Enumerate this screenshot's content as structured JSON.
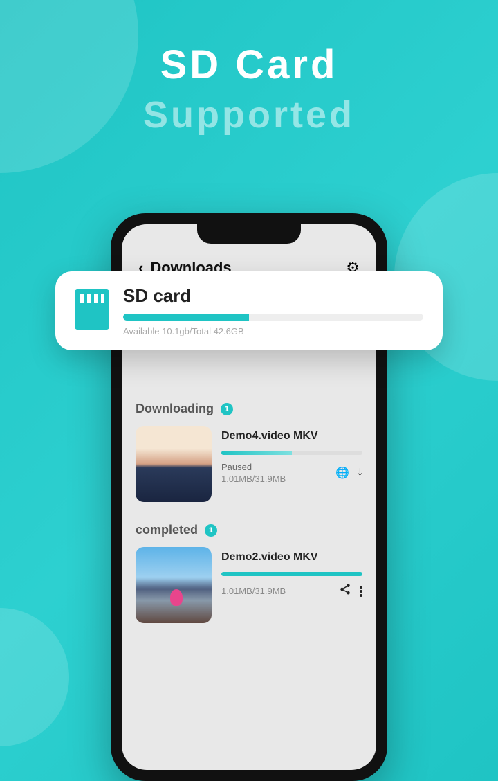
{
  "hero": {
    "line1": "SD Card",
    "line2": "Supported"
  },
  "header": {
    "title": "Downloads"
  },
  "sdCard": {
    "title": "SD  card",
    "stats": "Available 10.1gb/Total 42.6GB",
    "usedPercent": 42
  },
  "sections": {
    "downloading": {
      "title": "Downloading",
      "count": "1",
      "items": [
        {
          "title": "Demo4.video MKV",
          "status": "Paused",
          "size": "1.01MB/31.9MB",
          "progress": 50
        }
      ]
    },
    "completed": {
      "title": "completed",
      "count": "1",
      "items": [
        {
          "title": "Demo2.video MKV",
          "size": "1.01MB/31.9MB",
          "progress": 100
        }
      ]
    }
  }
}
